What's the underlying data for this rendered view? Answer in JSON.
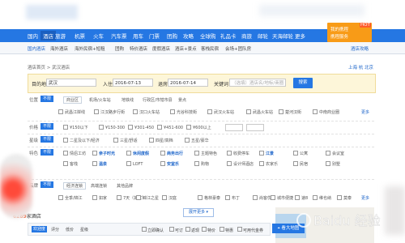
{
  "nav": {
    "items": [
      "国内",
      "酒店",
      "旅游",
      "机票",
      "火车",
      "汽车票",
      "用车",
      "门票",
      "团购",
      "攻略",
      "全球购",
      "礼品卡",
      "商旅",
      "邮轮",
      "天海邮轮",
      "更多"
    ],
    "active_index": 1,
    "user_line1": "我的携程",
    "user_line2": "携程服务",
    "badge": "HOT"
  },
  "subnav": {
    "items": [
      "国内酒店",
      "海外酒店",
      "海外民宿+短租",
      "团购",
      "特价酒店",
      "度假酒店",
      "酒店+景点",
      "客栈民宿",
      "会场+团队房"
    ],
    "active_index": 0,
    "right": "酒店攻略"
  },
  "breadcrumb": "酒店首页 > 武汉酒店",
  "right_links": "上海 杭 北京",
  "search": {
    "dest_label": "目的地",
    "dest_value": "武汉",
    "checkin_label": "入住",
    "checkin_value": "2016-07-13",
    "checkout_label": "退房",
    "checkout_value": "2016-07-14",
    "keyword_label": "关键词",
    "keyword_placeholder": "（选填）酒店名/地标/商圈",
    "button": "搜索"
  },
  "filters": {
    "unlimited": "不限",
    "more": "更多",
    "location": {
      "label": "位置",
      "tabs": [
        "商业区",
        "机场/火车站",
        "地铁线",
        "行政区/市辖市县",
        "景点"
      ],
      "options": [
        "武昌江岸线",
        "江汉路步行街",
        "汉口火车站",
        "光谷科技街",
        "武汉火车站",
        "武昌火车站",
        "楚河汉街",
        "中南商业圈"
      ]
    },
    "price": {
      "label": "价格",
      "options": [
        "¥150以下",
        "¥150-300",
        "¥301-450",
        "¥451-600",
        "¥600以上"
      ]
    },
    "star": {
      "label": "星级",
      "options": [
        "二星及以下/经济",
        "三星/舒适",
        "四星/高档",
        "五星/豪华"
      ]
    },
    "feature": {
      "label": "特色",
      "options": [
        "情侣工坊",
        "亲子时光",
        "休闲度假",
        "商务出行",
        "主题特色",
        "收费停车",
        "江景",
        "公寓",
        "会议室",
        "客栈",
        "温泉",
        "LOFT",
        "安室乐",
        "购物",
        "设计师酒店",
        "农家乐",
        "民宿",
        "别墅"
      ]
    },
    "brand": {
      "label": "品牌",
      "tabs": [
        "经济连锁",
        "高端连锁",
        "其他品牌"
      ],
      "options": [
        "全季/锦江",
        "如家",
        "7天（如家）",
        "锦江之星",
        "汉庭",
        "格林豪泰",
        "布丁",
        "尚客优",
        "城市便捷",
        "速8",
        "维也纳",
        "莫泰"
      ]
    },
    "expand": "展开更多"
  },
  "results": {
    "count": "6289",
    "count_suffix": "家酒店"
  },
  "sortbar": {
    "items": [
      "欢迎度",
      "评分",
      "低价",
      "星级"
    ],
    "checkboxes": [
      "立即确认",
      "可订",
      "返现",
      "特价",
      "特惠",
      "可用代金券"
    ]
  },
  "map_button": "看大地图",
  "watermark": "Baidu 经验",
  "colors": {
    "nav": "#2577e3",
    "accent": "#f89b17",
    "search_bg": "#fdf6d9",
    "count": "#e84c1c"
  }
}
